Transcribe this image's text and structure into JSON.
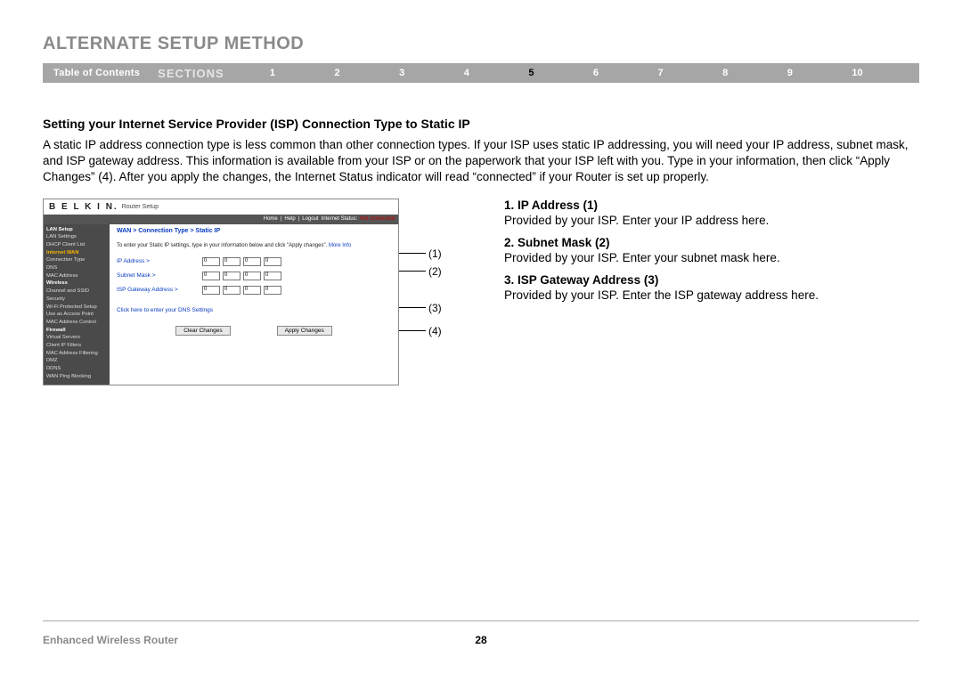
{
  "header": {
    "title": "ALTERNATE SETUP METHOD"
  },
  "navbar": {
    "toc": "Table of Contents",
    "sections": "SECTIONS",
    "numbers": [
      "1",
      "2",
      "3",
      "4",
      "5",
      "6",
      "7",
      "8",
      "9",
      "10"
    ],
    "active_index": 4
  },
  "section": {
    "heading": "Setting your Internet Service Provider (ISP) Connection Type to Static IP",
    "paragraph": "A static IP address connection type is less common than other connection types. If your ISP uses static IP addressing, you will need your IP address, subnet mask, and ISP gateway address. This information is available from your ISP or on the paperwork that your ISP left with you. Type in your information, then click “Apply Changes” (4). After you apply the changes, the Internet Status indicator will read “connected” if your Router is set up properly."
  },
  "descriptions": [
    {
      "title": "1.   IP Address (1)",
      "text": "Provided by your ISP. Enter your IP address here."
    },
    {
      "title": "2.   Subnet Mask (2)",
      "text": "Provided by your ISP. Enter your subnet mask here."
    },
    {
      "title": "3.   ISP Gateway Address (3)",
      "text": "Provided by your ISP. Enter the ISP gateway address here."
    }
  ],
  "figure_ui": {
    "brand": "B E L K I N.",
    "brand_sub": "Router Setup",
    "topbar": {
      "home": "Home",
      "help": "Help",
      "logout": "Logout",
      "status_label": "Internet Status:",
      "status_value": "Not connected"
    },
    "sidebar": {
      "items": [
        {
          "label": "LAN Setup",
          "cls": "s-head"
        },
        {
          "label": "LAN Settings",
          "cls": ""
        },
        {
          "label": "DHCP Client List",
          "cls": ""
        },
        {
          "label": "Internet WAN",
          "cls": "s-active"
        },
        {
          "label": "Connection Type",
          "cls": ""
        },
        {
          "label": "DNS",
          "cls": ""
        },
        {
          "label": "MAC Address",
          "cls": ""
        },
        {
          "label": "Wireless",
          "cls": "s-head"
        },
        {
          "label": "Channel and SSID",
          "cls": ""
        },
        {
          "label": "Security",
          "cls": ""
        },
        {
          "label": "Wi-Fi Protected Setup",
          "cls": ""
        },
        {
          "label": "Use as Access Point",
          "cls": ""
        },
        {
          "label": "MAC Address Control",
          "cls": ""
        },
        {
          "label": "Firewall",
          "cls": "s-head"
        },
        {
          "label": "Virtual Servers",
          "cls": ""
        },
        {
          "label": "Client IP Filters",
          "cls": ""
        },
        {
          "label": "MAC Address Filtering",
          "cls": ""
        },
        {
          "label": "DMZ",
          "cls": ""
        },
        {
          "label": "DDNS",
          "cls": ""
        },
        {
          "label": "WAN Ping Blocking",
          "cls": ""
        }
      ]
    },
    "main": {
      "breadcrumb": "WAN > Connection Type > Static IP",
      "instruction": "To enter your Static IP settings, type in your information below and click \"Apply changes\".",
      "more_info": "More Info",
      "rows": [
        {
          "label": "IP Address >",
          "octets": [
            "0",
            "0",
            "0",
            "0"
          ]
        },
        {
          "label": "Subnet Mask >",
          "octets": [
            "0",
            "0",
            "0",
            "0"
          ]
        },
        {
          "label": "ISP Gateway Address >",
          "octets": [
            "0",
            "0",
            "0",
            "0"
          ]
        }
      ],
      "dns_link": "Click here to enter your DNS Settings",
      "buttons": {
        "clear": "Clear Changes",
        "apply": "Apply Changes"
      }
    }
  },
  "callouts": [
    "(1)",
    "(2)",
    "(3)",
    "(4)"
  ],
  "footer": {
    "left": "Enhanced Wireless Router",
    "page": "28"
  }
}
